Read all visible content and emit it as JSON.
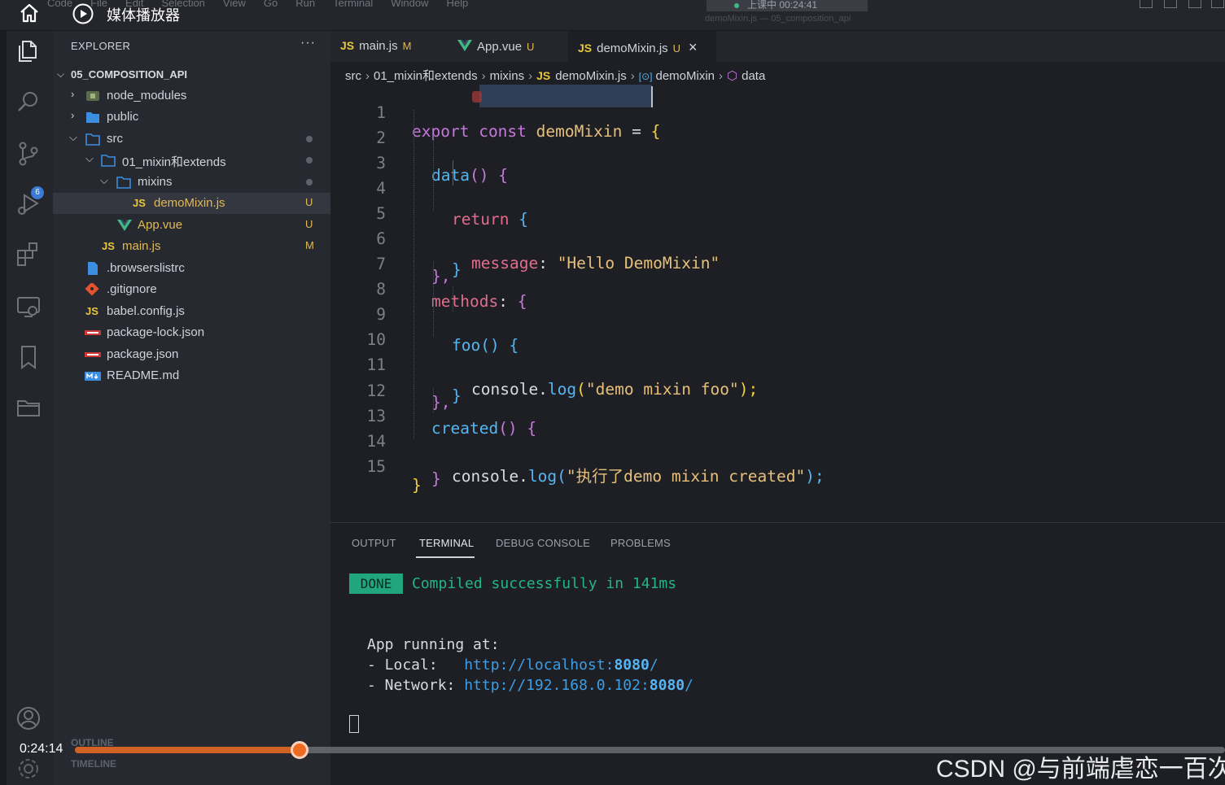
{
  "top": {
    "menu": [
      "Code",
      "File",
      "Edit",
      "Selection",
      "View",
      "Go",
      "Run",
      "Terminal",
      "Window",
      "Help"
    ],
    "player_title": "媒体播放器",
    "class_status": "上课中 00:24:41",
    "window_subtitle": "demoMixin.js — 05_composition_api"
  },
  "activity": {
    "items": [
      "explorer-icon",
      "search-icon",
      "source-control-icon",
      "run-debug-icon",
      "extensions-icon",
      "remote-explorer-icon",
      "bookmark-icon",
      "folder-icon",
      "account-icon",
      "settings-icon"
    ],
    "scm_badge": "6"
  },
  "sidebar": {
    "title": "EXPLORER",
    "more": "···",
    "project": "05_COMPOSITION_API",
    "tree": [
      {
        "label": "node_modules",
        "status": ""
      },
      {
        "label": "public",
        "status": ""
      },
      {
        "label": "src",
        "status": ""
      },
      {
        "label": "01_mixin和extends",
        "status": ""
      },
      {
        "label": "mixins",
        "status": ""
      },
      {
        "label": "demoMixin.js",
        "status": "U"
      },
      {
        "label": "App.vue",
        "status": "U"
      },
      {
        "label": "main.js",
        "status": "M"
      },
      {
        "label": ".browserslistrc",
        "status": ""
      },
      {
        "label": ".gitignore",
        "status": ""
      },
      {
        "label": "babel.config.js",
        "status": ""
      },
      {
        "label": "package-lock.json",
        "status": ""
      },
      {
        "label": "package.json",
        "status": ""
      },
      {
        "label": "README.md",
        "status": ""
      }
    ],
    "outline": "OUTLINE",
    "timeline": "TIMELINE"
  },
  "tabs": [
    {
      "icon": "JS",
      "label": "main.js",
      "status": "M"
    },
    {
      "icon": "V",
      "label": "App.vue",
      "status": "U"
    },
    {
      "icon": "JS",
      "label": "demoMixin.js",
      "status": "U",
      "close": "×"
    }
  ],
  "breadcrumb": {
    "items": [
      "src",
      "01_mixin和extends",
      "mixins",
      "demoMixin.js",
      "demoMixin",
      "data"
    ],
    "js": "JS"
  },
  "code": {
    "line_numbers": [
      "1",
      "2",
      "3",
      "4",
      "5",
      "6",
      "7",
      "8",
      "9",
      "10",
      "11",
      "12",
      "13",
      "14",
      "15"
    ],
    "l1": {
      "a": "export",
      "b": "const",
      "c": "demoMixin",
      "d": "=",
      "e": "{"
    },
    "l2": {
      "a": "data",
      "b": "()",
      "c": "{"
    },
    "l3": {
      "a": "return",
      "b": "{"
    },
    "l4": {
      "a": "message",
      "b": ":",
      "c": "\"Hello DemoMixin\""
    },
    "l5": {
      "a": "}"
    },
    "l6": {
      "a": "},"
    },
    "l7": {
      "a": "methods",
      "b": ":",
      "c": "{"
    },
    "l8": {
      "a": "foo",
      "b": "()",
      "c": "{"
    },
    "l9": {
      "a": "console.",
      "b": "log",
      "c": "(",
      "d": "\"demo mixin foo\"",
      "e": ");"
    },
    "l10": {
      "a": "}"
    },
    "l11": {
      "a": "},"
    },
    "l12": {
      "a": "created",
      "b": "()",
      "c": "{"
    },
    "l13": {
      "a": "console.",
      "b": "log",
      "c": "(",
      "d": "\"执行了demo mixin created\"",
      "e": ");"
    },
    "l14": {
      "a": "}"
    },
    "l15": {
      "a": "}"
    }
  },
  "panel": {
    "tabs": [
      "OUTPUT",
      "TERMINAL",
      "DEBUG CONSOLE",
      "PROBLEMS"
    ],
    "done": "DONE",
    "compiled": "Compiled successfully in 141ms",
    "running": "App running at:",
    "local_label": "- Local:   ",
    "local_url_a": "http://localhost:",
    "local_port": "8080",
    "local_url_b": "/",
    "network_label": "- Network: ",
    "network_url_a": "http://192.168.0.102:",
    "network_port": "8080",
    "network_url_b": "/"
  },
  "video": {
    "time": "0:24:14",
    "progress": 0.195,
    "watermark": "CSDN @与前端虐恋一百次"
  },
  "colors": {
    "accent_orange": "#f06b22",
    "done_green": "#20a67a",
    "js_yellow": "#e8c73a",
    "vue_green": "#41b883"
  }
}
